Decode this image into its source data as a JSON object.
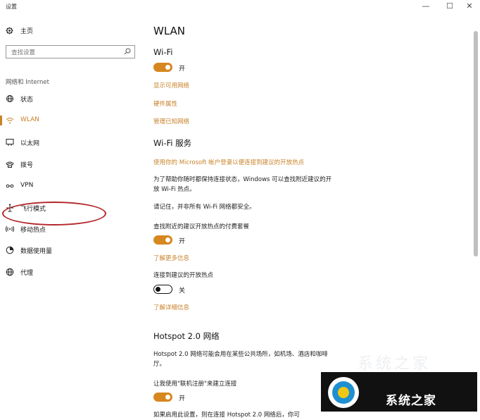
{
  "window": {
    "title": "设置",
    "minimize": "—",
    "maximize": "☐",
    "close": "✕"
  },
  "sidebar": {
    "home_label": "主页",
    "search_placeholder": "查找设置",
    "section_label": "网络和 Internet",
    "items": [
      {
        "label": "状态",
        "icon": "globe-status-icon"
      },
      {
        "label": "WLAN",
        "icon": "wifi-icon",
        "active": true
      },
      {
        "label": "以太网",
        "icon": "ethernet-icon"
      },
      {
        "label": "拨号",
        "icon": "phone-icon"
      },
      {
        "label": "VPN",
        "icon": "vpn-icon"
      },
      {
        "label": "飞行模式",
        "icon": "airplane-icon"
      },
      {
        "label": "移动热点",
        "icon": "hotspot-icon"
      },
      {
        "label": "数据使用量",
        "icon": "data-usage-icon"
      },
      {
        "label": "代理",
        "icon": "globe-proxy-icon"
      }
    ]
  },
  "main": {
    "title": "WLAN",
    "wifi": {
      "heading": "Wi-Fi",
      "toggle_state": "开",
      "links": [
        "显示可用网络",
        "硬件属性",
        "管理已知网络"
      ]
    },
    "wifi_service": {
      "heading": "Wi-Fi 服务",
      "signin_link": "使用你的 Microsoft 帐户登录以便连接到建议的开放热点",
      "description_line1": "为了帮助你随时都保持连接状态，Windows 可以查找附近建议的开",
      "description_line2": "放 Wi-Fi 热点。",
      "reminder": "请记住，并非所有 Wi-Fi 网络都安全。",
      "paid_plans_label": "查找附近的建议开放热点的付费套餐",
      "paid_plans_toggle": "开",
      "learn_more": "了解更多信息",
      "suggested_label": "连接到建议的开放热点",
      "suggested_toggle": "关",
      "details_link": "了解详细信息"
    },
    "hotspot20": {
      "heading": "Hotspot 2.0 网络",
      "description_line1": "Hotspot 2.0 网络可能会用在某些公共场所，如机场、酒店和咖啡",
      "description_line2": "厅。",
      "online_signup_label": "让我使用\"联机注册\"来建立连接",
      "online_signup_toggle": "开",
      "truncated_text": "如果启用此设置，则在连接 Hotspot 2.0 网络后，你可"
    }
  },
  "watermark": {
    "text": "系统之家"
  },
  "colors": {
    "accent": "#c8822a",
    "toggle_on": "#d6871f",
    "highlight": "#b3272d"
  }
}
